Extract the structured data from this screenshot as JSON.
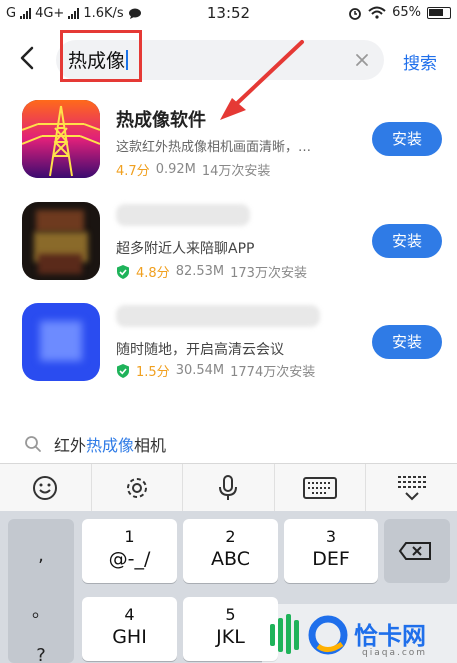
{
  "status_bar": {
    "carrier": "G",
    "network": "4G+",
    "speed": "1.6K/s",
    "time": "13:52",
    "battery": "65%"
  },
  "search": {
    "query": "热成像",
    "button_label": "搜索"
  },
  "apps": [
    {
      "name": "热成像软件",
      "description": "这款红外热成像相机画面清晰，…",
      "rating": "4.7分",
      "size": "0.92M",
      "installs": "14万次安装",
      "install_label": "安装",
      "verified": false
    },
    {
      "name": "",
      "description": "超多附近人来陪聊APP",
      "rating": "4.8分",
      "size": "82.53M",
      "installs": "173万次安装",
      "install_label": "安装",
      "verified": true
    },
    {
      "name": "",
      "description": "随时随地，开启高清云会议",
      "rating": "1.5分",
      "size": "30.54M",
      "installs": "1774万次安装",
      "install_label": "安装",
      "verified": true
    }
  ],
  "suggestion": {
    "prefix": "红外",
    "match": "热成像",
    "suffix": "相机"
  },
  "keyboard": {
    "side_keys": [
      ",",
      "。",
      "?"
    ],
    "keys": [
      {
        "num": "1",
        "letters": "@-_/"
      },
      {
        "num": "2",
        "letters": "ABC"
      },
      {
        "num": "3",
        "letters": "DEF"
      },
      {
        "num": "4",
        "letters": "GHI"
      },
      {
        "num": "5",
        "letters": "JKL"
      }
    ]
  },
  "watermark": {
    "brand": "恰卡网",
    "domain": "qiaqa.com"
  },
  "colors": {
    "accent": "#2f7be6",
    "annotation_red": "#e53935",
    "rating": "#f0a020",
    "verified": "#1fb35a"
  }
}
